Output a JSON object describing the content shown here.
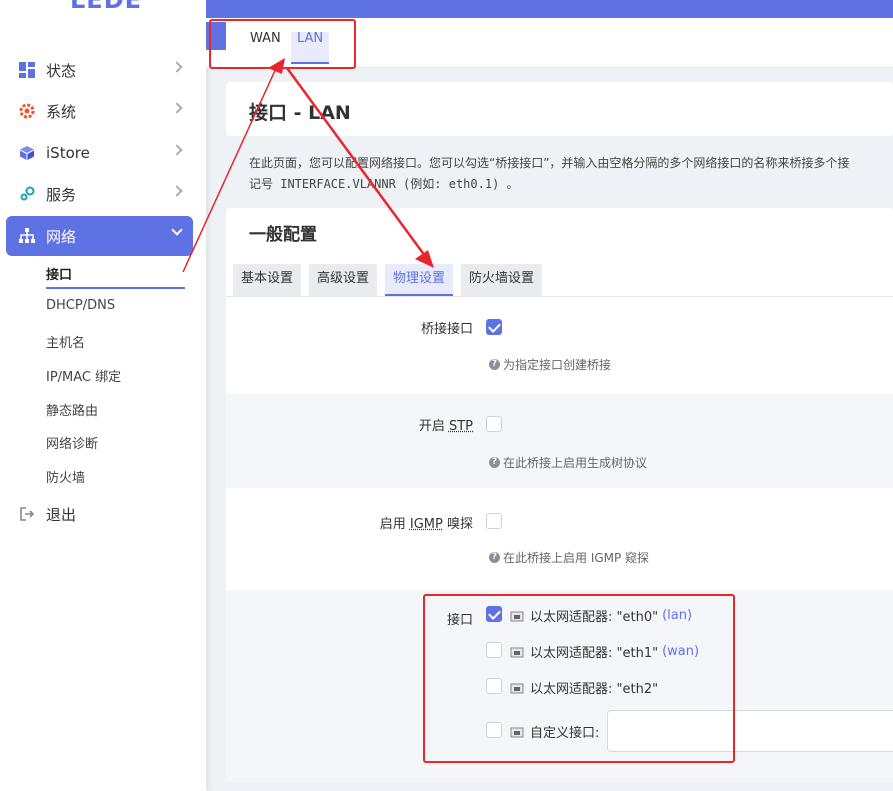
{
  "brand": {
    "logo": "LEDE"
  },
  "sidebar": {
    "items": [
      {
        "label": "状态",
        "icon": "dashboard-icon"
      },
      {
        "label": "系统",
        "icon": "gear-icon"
      },
      {
        "label": "iStore",
        "icon": "cube-icon"
      },
      {
        "label": "服务",
        "icon": "services-icon"
      },
      {
        "label": "网络",
        "icon": "network-icon"
      },
      {
        "label": "退出",
        "icon": "logout-icon"
      }
    ],
    "network_sub": [
      "接口",
      "DHCP/DNS",
      "主机名",
      "IP/MAC 绑定",
      "静态路由",
      "网络诊断",
      "防火墙"
    ]
  },
  "iface_tabs": [
    "WAN",
    "LAN"
  ],
  "page": {
    "title": "接口 - LAN",
    "desc_line1": "在此页面，您可以配置网络接口。您可以勾选“桥接接口”，并输入由空格分隔的多个网络接口的名称来桥接多个接",
    "desc_line2": "记号 INTERFACE.VLANNR (例如: eth0.1) 。"
  },
  "section": {
    "title": "一般配置",
    "tabs": [
      "基本设置",
      "高级设置",
      "物理设置",
      "防火墙设置"
    ]
  },
  "fields": {
    "bridge": {
      "label": "桥接接口",
      "hint": "为指定接口创建桥接",
      "checked": true
    },
    "stp": {
      "label_pre": "开启 ",
      "label_abbr": "STP",
      "hint": "在此桥接上启用生成树协议",
      "checked": false
    },
    "igmp": {
      "label_pre": "启用 ",
      "label_abbr": "IGMP",
      "label_post": " 嗅探",
      "hint": "在此桥接上启用 IGMP 窥探",
      "checked": false
    },
    "iface": {
      "label": "接口",
      "ports": [
        {
          "text": "以太网适配器: \"eth0\"",
          "net": "(lan)",
          "checked": true
        },
        {
          "text": "以太网适配器: \"eth1\"",
          "net": "(wan)",
          "checked": false
        },
        {
          "text": "以太网适配器: \"eth2\"",
          "net": "",
          "checked": false
        }
      ],
      "custom_label": "自定义接口:",
      "custom_value": ""
    }
  },
  "colors": {
    "accent": "#5e72e4",
    "annotation": "#e8262b"
  }
}
